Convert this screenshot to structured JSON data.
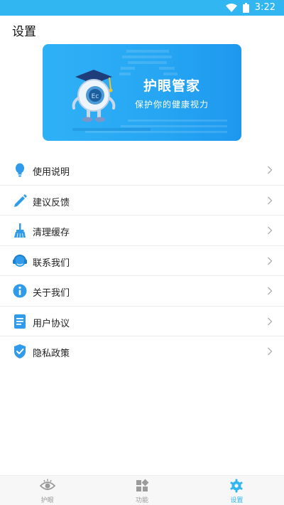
{
  "status_bar": {
    "time": "3:22"
  },
  "page": {
    "title": "设置"
  },
  "banner": {
    "title": "护眼管家",
    "subtitle": "保护你的健康视力",
    "mascot_badge": "Ec"
  },
  "menu": [
    {
      "label": "使用说明",
      "icon": "lightbulb-icon"
    },
    {
      "label": "建议反馈",
      "icon": "pencil-icon"
    },
    {
      "label": "清理缓存",
      "icon": "broom-icon"
    },
    {
      "label": "联系我们",
      "icon": "headset-icon"
    },
    {
      "label": "关于我们",
      "icon": "info-icon"
    },
    {
      "label": "用户协议",
      "icon": "document-icon"
    },
    {
      "label": "隐私政策",
      "icon": "shield-check-icon"
    }
  ],
  "bottom_nav": [
    {
      "label": "护眼",
      "icon": "eye-icon",
      "active": false
    },
    {
      "label": "功能",
      "icon": "grid-icon",
      "active": false
    },
    {
      "label": "设置",
      "icon": "gear-icon",
      "active": true
    }
  ],
  "colors": {
    "accent": "#31b6f2",
    "icon_blue": "#2f9bea",
    "inactive": "#9b9b9b"
  }
}
